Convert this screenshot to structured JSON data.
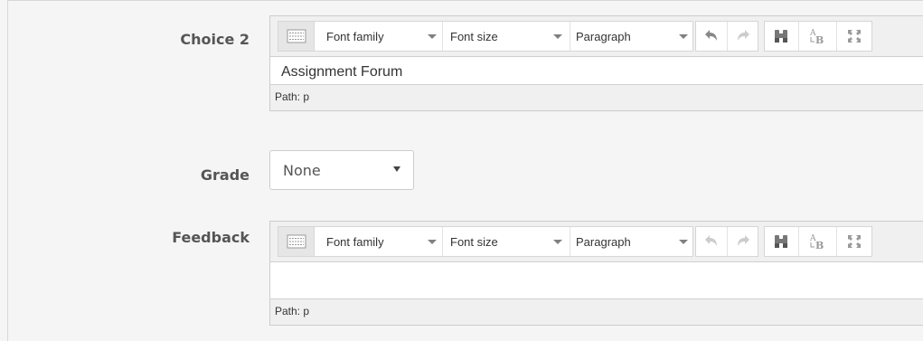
{
  "fields": {
    "choice2": {
      "label": "Choice 2",
      "content": "Assignment Forum",
      "path": "Path: p"
    },
    "grade": {
      "label": "Grade",
      "selected": "None"
    },
    "feedback": {
      "label": "Feedback",
      "content": "",
      "path": "Path: p"
    }
  },
  "toolbar": {
    "font_family": "Font family",
    "font_size": "Font size",
    "format": "Paragraph",
    "icons": [
      "toolbar-toggle-icon",
      "undo-icon",
      "redo-icon",
      "find-replace-icon",
      "spellcheck-icon",
      "fullscreen-icon"
    ]
  },
  "colors": {
    "background": "#f5f5f5",
    "label_text": "#555555",
    "toolbar_bg": "#f0f0f0",
    "border": "#cccccc",
    "icon_active": "#888888",
    "icon_disabled": "#cccccc"
  }
}
